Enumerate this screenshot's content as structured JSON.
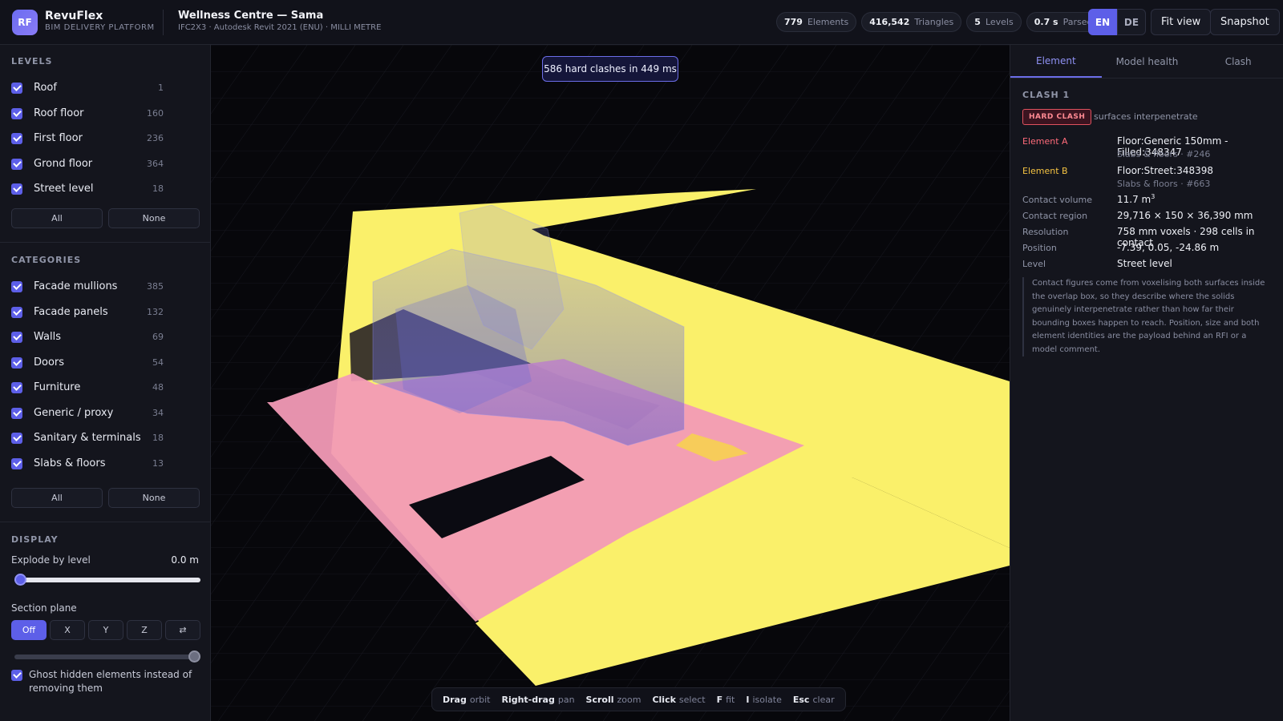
{
  "app": {
    "logo_text": "RF",
    "name": "RevuFlex",
    "tagline": "BIM DELIVERY PLATFORM"
  },
  "project": {
    "title": "Wellness Centre — Sama",
    "meta": "IFC2X3 · Autodesk Revit 2021 (ENU) · MILLI METRE"
  },
  "stats": [
    {
      "value": "779",
      "label": "Elements"
    },
    {
      "value": "416,542",
      "label": "Triangles"
    },
    {
      "value": "5",
      "label": "Levels"
    },
    {
      "value": "0.7 s",
      "label": "Parsed in"
    }
  ],
  "language": {
    "active": "EN",
    "other": "DE"
  },
  "header_buttons": {
    "fit": "Fit view",
    "snapshot": "Snapshot"
  },
  "levels": {
    "title": "LEVELS",
    "items": [
      {
        "label": "Roof",
        "count": "1",
        "checked": true
      },
      {
        "label": "Roof floor",
        "count": "160",
        "checked": true
      },
      {
        "label": "First floor",
        "count": "236",
        "checked": true
      },
      {
        "label": "Grond floor",
        "count": "364",
        "checked": true
      },
      {
        "label": "Street level",
        "count": "18",
        "checked": true
      }
    ],
    "all_label": "All",
    "none_label": "None"
  },
  "categories": {
    "title": "CATEGORIES",
    "items": [
      {
        "label": "Facade mullions",
        "count": "385",
        "checked": true
      },
      {
        "label": "Facade panels",
        "count": "132",
        "checked": true
      },
      {
        "label": "Walls",
        "count": "69",
        "checked": true
      },
      {
        "label": "Doors",
        "count": "54",
        "checked": true
      },
      {
        "label": "Furniture",
        "count": "48",
        "checked": true
      },
      {
        "label": "Generic / proxy",
        "count": "34",
        "checked": true
      },
      {
        "label": "Sanitary & terminals",
        "count": "18",
        "checked": true
      },
      {
        "label": "Slabs & floors",
        "count": "13",
        "checked": true
      }
    ],
    "all_label": "All",
    "none_label": "None"
  },
  "display": {
    "title": "DISPLAY",
    "explode_label": "Explode by level",
    "explode_value": "0.0 m",
    "explode_fraction": 0,
    "section_label": "Section plane",
    "section_options": [
      "Off",
      "X",
      "Y",
      "Z",
      "⇄"
    ],
    "section_selected": "Off",
    "section_fraction": 1,
    "ghost_label": "Ghost hidden elements instead of removing them",
    "ghost_checked": true
  },
  "viewport": {
    "clash_banner": "586 hard clashes in 449 ms",
    "hints": [
      {
        "key": "Drag",
        "action": "orbit"
      },
      {
        "key": "Right-drag",
        "action": "pan"
      },
      {
        "key": "Scroll",
        "action": "zoom"
      },
      {
        "key": "Click",
        "action": "select"
      },
      {
        "key": "F",
        "action": "fit"
      },
      {
        "key": "I",
        "action": "isolate"
      },
      {
        "key": "Esc",
        "action": "clear"
      }
    ],
    "colors": {
      "slab_a": "#f29ab6",
      "slab_b": "#faf06a",
      "ghost": "#6c6cd8"
    }
  },
  "panel": {
    "tabs": [
      "Element",
      "Model health",
      "Clash"
    ],
    "active_tab": "Element",
    "clash_title": "CLASH 1",
    "badge": "HARD CLASH",
    "badge_note": "surfaces interpenetrate",
    "element_a_label": "Element A",
    "element_a_name": "Floor:Generic 150mm - Filled:348347",
    "element_a_sub": "Slabs & floors · #246",
    "element_b_label": "Element B",
    "element_b_name": "Floor:Street:348398",
    "element_b_sub": "Slabs & floors · #663",
    "contact_volume_label": "Contact volume",
    "contact_volume_value": "11.7 m",
    "contact_volume_unit_sup": "3",
    "contact_region_label": "Contact region",
    "contact_region_value": "29,716 × 150 × 36,390 mm",
    "resolution_label": "Resolution",
    "resolution_value": "758 mm voxels · 298 cells in contact",
    "position_label": "Position",
    "position_value": "-7.39, 0.05, -24.86 m",
    "level_label": "Level",
    "level_value": "Street level",
    "note": "Contact figures come from voxelising both surfaces inside the overlap box, so they describe where the solids genuinely interpenetrate rather than how far their bounding boxes happen to reach. Position, size and both element identities are the payload behind an RFI or a model comment."
  }
}
